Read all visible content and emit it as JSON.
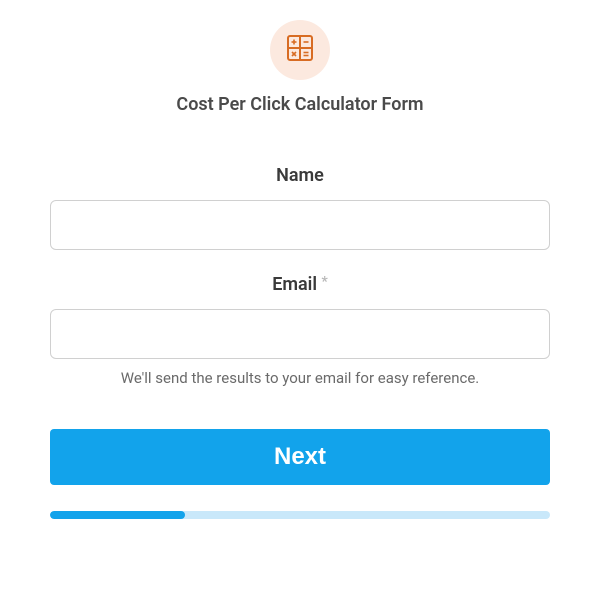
{
  "header": {
    "icon": "calculator-icon",
    "title": "Cost Per Click Calculator Form"
  },
  "fields": {
    "name": {
      "label": "Name",
      "value": "",
      "required": false
    },
    "email": {
      "label": "Email",
      "value": "",
      "required": true,
      "required_marker": "*",
      "helper": "We'll send the results to your email for easy reference."
    }
  },
  "button": {
    "next_label": "Next"
  },
  "progress": {
    "percent": 27
  },
  "colors": {
    "accent": "#12a3eb",
    "icon_bg": "#fce9df",
    "icon_stroke": "#d86c23"
  }
}
